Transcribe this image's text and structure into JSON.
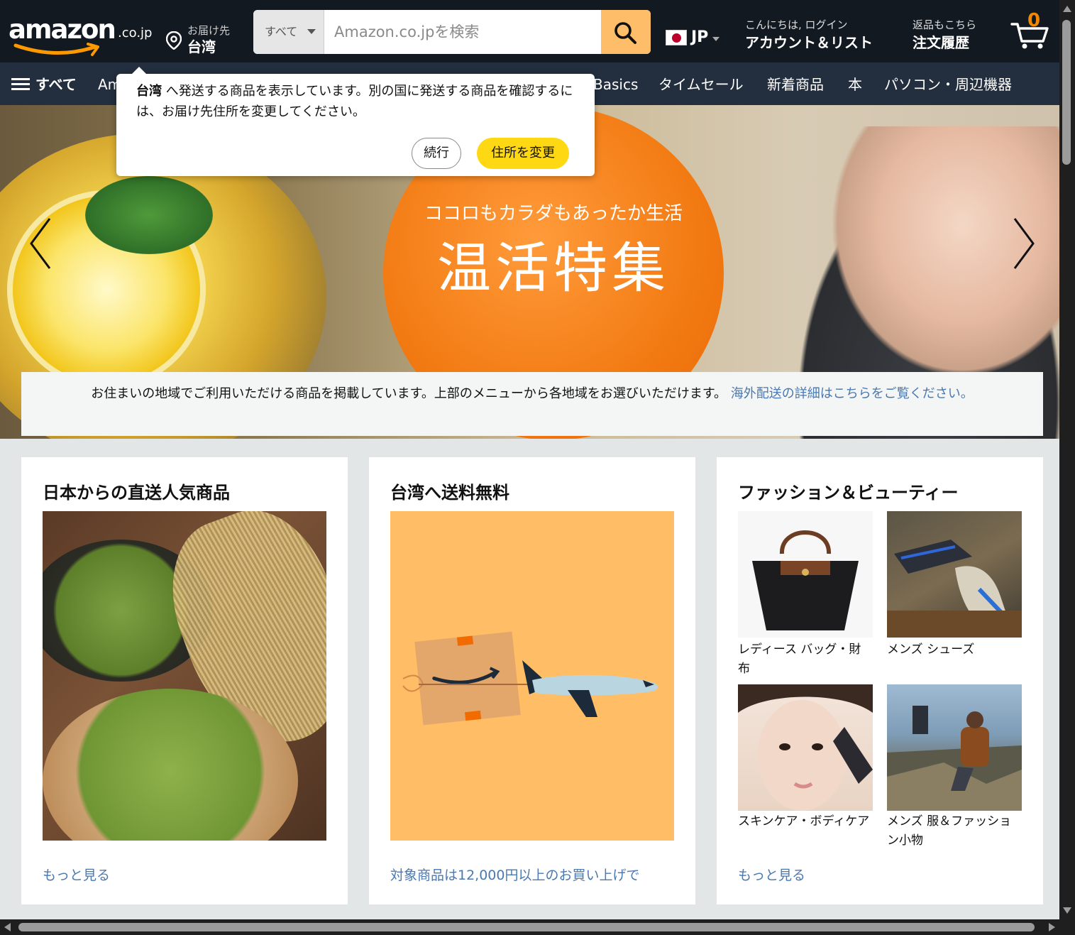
{
  "header": {
    "logo": {
      "word": "amazon",
      "tld": ".co.jp"
    },
    "deliver": {
      "line1": "お届け先",
      "line2": "台湾"
    },
    "search": {
      "category": "すべて",
      "placeholder": "Amazon.co.jpを検索"
    },
    "language": {
      "code": "JP"
    },
    "account": {
      "line1": "こんにちは, ログイン",
      "line2": "アカウント＆リスト"
    },
    "orders": {
      "line1": "返品もこちら",
      "line2": "注文履歴"
    },
    "cart": {
      "count": "0"
    }
  },
  "subnav": {
    "all_label": "すべて",
    "items": [
      {
        "label": "Am"
      },
      {
        "label": "Basics"
      },
      {
        "label": "タイムセール"
      },
      {
        "label": "新着商品"
      },
      {
        "label": "本"
      },
      {
        "label": "パソコン・周辺機器"
      }
    ]
  },
  "popover": {
    "msg_bold": "台湾",
    "msg_rest": " へ発送する商品を表示しています。別の国に発送する商品を確認するには、お届け先住所を変更してください。",
    "continue_label": "続行",
    "change_label": "住所を変更"
  },
  "hero": {
    "subtitle": "ココロもカラダもあったか生活",
    "title": "温活特集"
  },
  "notice": {
    "text": "お住まいの地域でご利用いただける商品を掲載しています。上部のメニューから各地域をお選びいただけます。 ",
    "link": "海外配送の詳細はこちらをご覧ください。"
  },
  "cards": [
    {
      "title": "日本からの直送人気商品",
      "link": "もっと見る"
    },
    {
      "title": "台湾へ送料無料",
      "link": "対象商品は12,000円以上のお買い上げで"
    },
    {
      "title": "ファッション＆ビューティー",
      "tiles": [
        {
          "label": "レディース バッグ・財布"
        },
        {
          "label": "メンズ シューズ"
        },
        {
          "label": "スキンケア・ボディケア"
        },
        {
          "label": "メンズ 服＆ファッション小物"
        }
      ],
      "link": "もっと見る"
    }
  ],
  "colors": {
    "nav_dark": "#131921",
    "nav_sub": "#232f3e",
    "search_button": "#febd69",
    "cart_count": "#f08804",
    "primary_button": "#ffd814",
    "link": "#4a78b0",
    "hero_orange": "#f27a12"
  },
  "icons": {
    "location": "location-pin-icon",
    "search": "search-icon",
    "cart": "cart-icon",
    "menu": "hamburger-icon",
    "prev": "chevron-left-icon",
    "next": "chevron-right-icon"
  }
}
